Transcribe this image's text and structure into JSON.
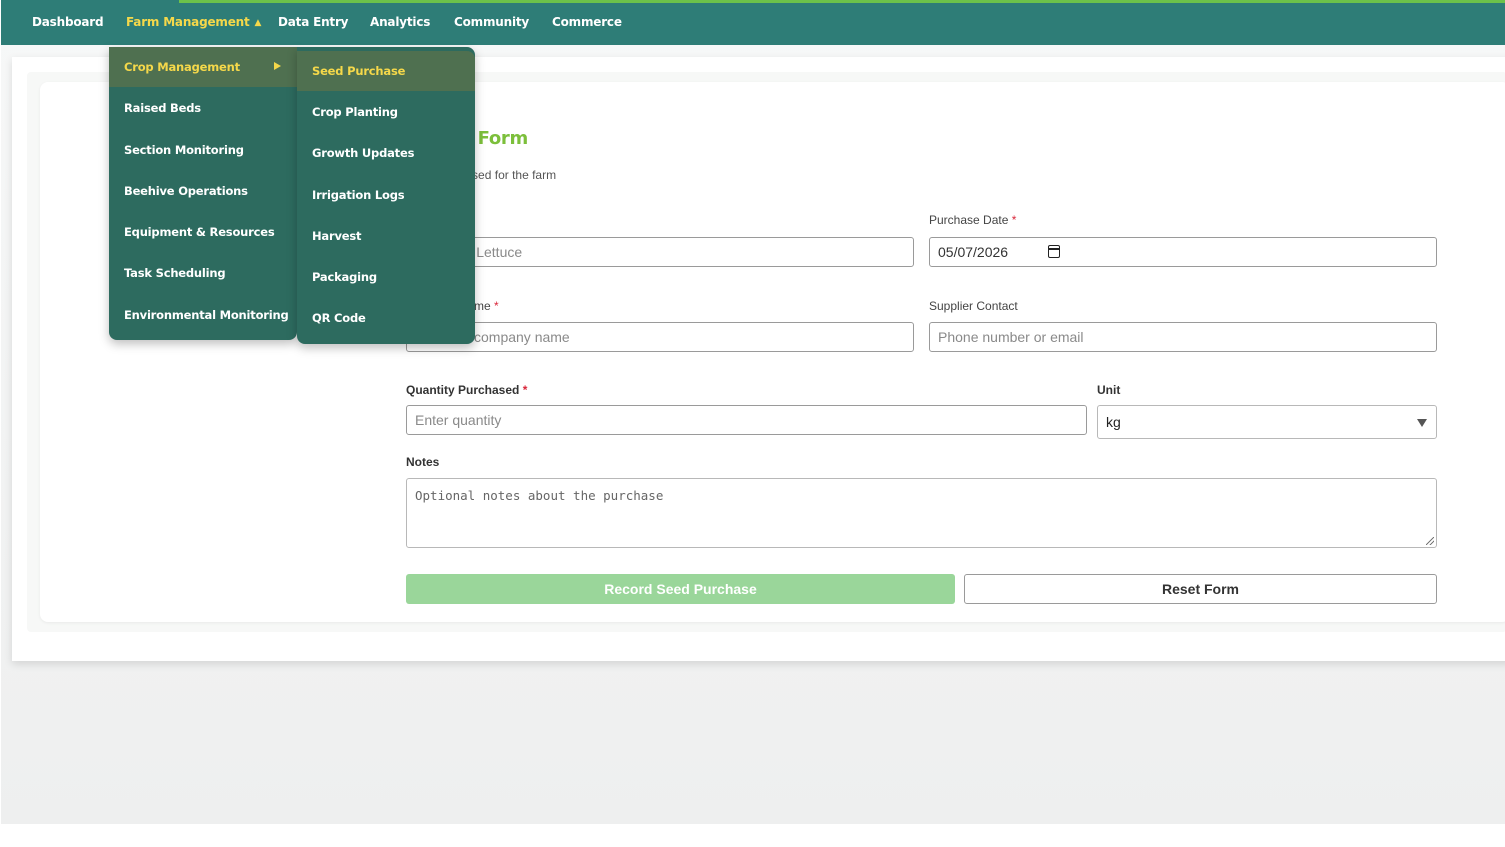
{
  "nav": {
    "items": [
      {
        "label": "Dashboard"
      },
      {
        "label": "Farm Management",
        "caret": "▲"
      },
      {
        "label": "Data Entry"
      },
      {
        "label": "Analytics"
      },
      {
        "label": "Community"
      },
      {
        "label": "Commerce"
      }
    ]
  },
  "farm_menu": {
    "items": [
      {
        "label": "Crop Management"
      },
      {
        "label": "Raised Beds"
      },
      {
        "label": "Section Monitoring"
      },
      {
        "label": "Beehive Operations"
      },
      {
        "label": "Equipment & Resources"
      },
      {
        "label": "Task Scheduling"
      },
      {
        "label": "Environmental Monitoring"
      }
    ]
  },
  "crop_submenu": {
    "items": [
      {
        "label": "Seed Purchase"
      },
      {
        "label": "Crop Planting"
      },
      {
        "label": "Growth Updates"
      },
      {
        "label": "Irrigation Logs"
      },
      {
        "label": "Harvest"
      },
      {
        "label": "Packaging"
      },
      {
        "label": "QR Code"
      }
    ]
  },
  "form": {
    "title": "rchase Form",
    "subtitle": "eeds purchased for the farm",
    "crop_placeholder": ", Tomato, Lettuce",
    "purchase_date_label": "Purchase Date",
    "purchase_date_value": "05/07/2026",
    "supplier_name_label": "me",
    "supplier_name_placeholder": "company name",
    "supplier_contact_label": "Supplier Contact",
    "supplier_contact_placeholder": "Phone number or email",
    "quantity_label": "Quantity Purchased",
    "quantity_placeholder": "Enter quantity",
    "unit_label": "Unit",
    "unit_value": "kg",
    "notes_label": "Notes",
    "notes_placeholder": "Optional notes about the purchase",
    "submit_label": "Record Seed Purchase",
    "reset_label": "Reset Form",
    "required_mark": "*"
  },
  "colors": {
    "nav_bg": "#2e7d77",
    "menu_bg": "#2d6b5f",
    "menu_highlight": "#4f7050",
    "active_text": "#f5d84a",
    "title_green": "#7cbf3b",
    "primary_button": "#9ad69a"
  }
}
